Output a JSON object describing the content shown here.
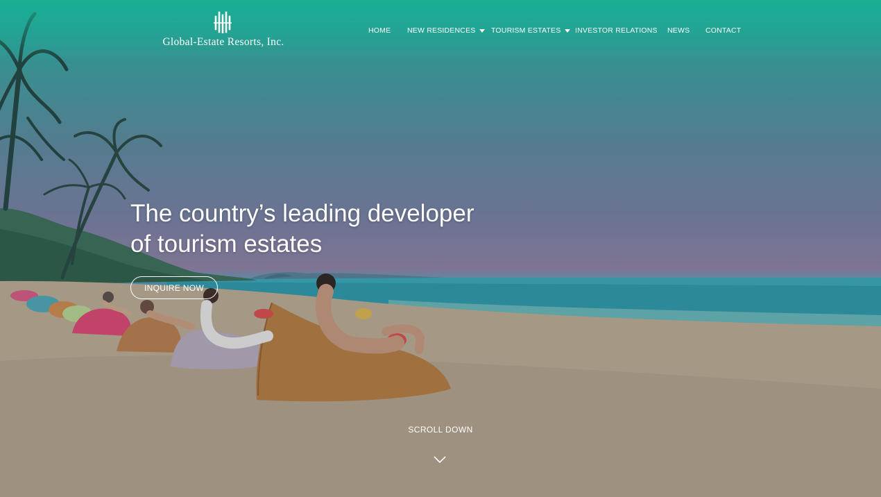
{
  "brand": {
    "name": "Global-Estate Resorts, Inc.",
    "accent": "#1db39b"
  },
  "nav": {
    "items": [
      {
        "label": "HOME",
        "has_dropdown": false
      },
      {
        "label": "NEW RESIDENCES",
        "has_dropdown": true
      },
      {
        "label": "TOURISM ESTATES",
        "has_dropdown": true
      },
      {
        "label": "INVESTOR RELATIONS",
        "has_dropdown": false
      },
      {
        "label": "NEWS",
        "has_dropdown": false
      },
      {
        "label": "CONTACT",
        "has_dropdown": false
      }
    ]
  },
  "hero": {
    "headline_line1": "The country’s leading developer",
    "headline_line2": "of tourism estates",
    "cta_label": "INQUIRE NOW",
    "scroll_label": "SCROLL DOWN",
    "scroll_icon": "chevron-down-icon"
  }
}
